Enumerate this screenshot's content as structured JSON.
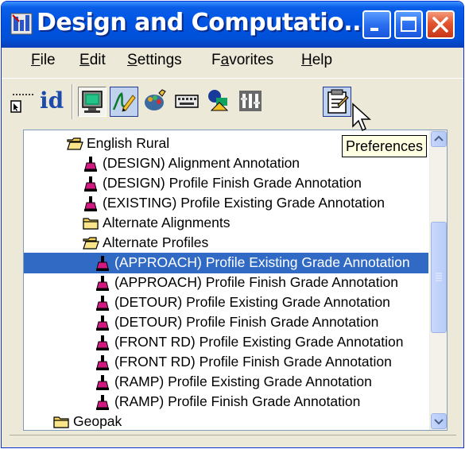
{
  "window": {
    "title": "Design and Computatio...",
    "icon": "app-icon",
    "controls": [
      "minimize-icon",
      "maximize-icon",
      "close-icon"
    ]
  },
  "menubar": {
    "items": [
      {
        "label": "File",
        "mnemonic": "F"
      },
      {
        "label": "Edit",
        "mnemonic": "E"
      },
      {
        "label": "Settings",
        "mnemonic": "S"
      },
      {
        "label": "Favorites",
        "mnemonic": "a"
      },
      {
        "label": "Help",
        "mnemonic": "H"
      }
    ]
  },
  "toolbar": {
    "id_label": "id",
    "tools": [
      "cursor-select-icon",
      "monitor-icon",
      "pencil-draw-icon",
      "paint-palette-icon",
      "keyboard-icon",
      "shapes-icon",
      "filter-icon",
      "preferences-icon"
    ]
  },
  "tooltip": {
    "text": "Preferences"
  },
  "tree": {
    "items": [
      {
        "label": "English Rural",
        "icon": "open-folder-icon",
        "level": 1
      },
      {
        "label": "(DESIGN) Alignment Annotation",
        "icon": "paintbrush-icon",
        "level": 2
      },
      {
        "label": "(DESIGN) Profile Finish Grade Annotation",
        "icon": "paintbrush-icon",
        "level": 2
      },
      {
        "label": "(EXISTING) Profile Existing Grade Annotation",
        "icon": "paintbrush-icon",
        "level": 2
      },
      {
        "label": "Alternate Alignments",
        "icon": "folder-icon",
        "level": 2
      },
      {
        "label": "Alternate Profiles",
        "icon": "open-folder-icon",
        "level": 2
      },
      {
        "label": "(APPROACH) Profile Existing Grade Annotation",
        "icon": "paintbrush-icon",
        "level": 3,
        "selected": true
      },
      {
        "label": "(APPROACH) Profile Finish Grade Annotation",
        "icon": "paintbrush-icon",
        "level": 3
      },
      {
        "label": "(DETOUR) Profile Existing Grade Annotation",
        "icon": "paintbrush-icon",
        "level": 3
      },
      {
        "label": "(DETOUR) Profile Finish Grade Annotation",
        "icon": "paintbrush-icon",
        "level": 3
      },
      {
        "label": "(FRONT RD) Profile Existing Grade Annotation",
        "icon": "paintbrush-icon",
        "level": 3
      },
      {
        "label": "(FRONT RD) Profile Finish Grade Annotation",
        "icon": "paintbrush-icon",
        "level": 3
      },
      {
        "label": "(RAMP) Profile Existing Grade Annotation",
        "icon": "paintbrush-icon",
        "level": 3
      },
      {
        "label": "(RAMP) Profile Finish Grade Annotation",
        "icon": "paintbrush-icon",
        "level": 3
      },
      {
        "label": "Geopak",
        "icon": "folder-icon",
        "level": 0
      }
    ]
  },
  "colors": {
    "titlebar": "#0054e3",
    "selection": "#316ac5",
    "tooltip_bg": "#ffffe1"
  }
}
